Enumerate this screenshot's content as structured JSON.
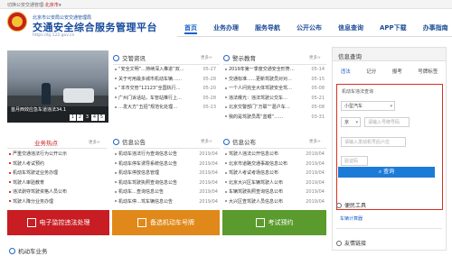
{
  "topbar": {
    "prefix": "切换公安交通管理:",
    "city": "北京市",
    "arrow": "▼"
  },
  "header": {
    "sub": "北京市公安局公安交通管理局",
    "title": "交通安全综合服务管理平台",
    "url": "https://bj.122.gov.cn"
  },
  "nav": [
    {
      "label": "首页"
    },
    {
      "label": "业务办理"
    },
    {
      "label": "服务导航"
    },
    {
      "label": "公开公布"
    },
    {
      "label": "信息查询"
    },
    {
      "label": "APP下载"
    },
    {
      "label": "办事指南"
    }
  ],
  "banner": {
    "caption": "首月西效应急车道违法34.1",
    "dots": [
      "1",
      "2",
      "3",
      "4",
      "5"
    ],
    "active": 3
  },
  "news": {
    "title": "交管资讯",
    "more": "更多>",
    "items": [
      {
        "t": "“安全文明”…持续深入推进“双…",
        "d": "05-27"
      },
      {
        "t": "关于可用最多城市机动车辆……",
        "d": "05-28"
      },
      {
        "t": "“本市交管“12123”全国执行…",
        "d": "05-20"
      },
      {
        "t": "广州门诉话站，车管站推行上…",
        "d": "05-28"
      },
      {
        "t": "…发大方“五招”规范化处理…",
        "d": "05-23"
      }
    ]
  },
  "warn": {
    "title": "警示教育",
    "more": "更多>",
    "items": [
      {
        "t": "2019年第一季度交通安全形势…",
        "d": "05-14"
      },
      {
        "t": "交通标准……更新驾驶员对对…",
        "d": "05-15"
      },
      {
        "t": "一个人问完全大体驾驶安全驾…",
        "d": "05-08"
      },
      {
        "t": "违法曝光：违法驾驶公交车…",
        "d": "05-21"
      },
      {
        "t": "北京交警部门“万联”“葛户车…",
        "d": "05-08"
      },
      {
        "t": "我的是驾驶员再“蓝眼”……",
        "d": "03-31"
      }
    ]
  },
  "hot": {
    "title": "业务热点",
    "more": "更多>",
    "items": [
      "严重交通违法行为公开公示",
      "驾驶人考试预约",
      "机动车驾驶证业务办理",
      "驾驶人审验教育",
      "违法剥夺驾驶资格人员公布",
      "驾驶人降分业务办理"
    ]
  },
  "info": {
    "title": "信息公告",
    "more": "更多>",
    "items": [
      {
        "t": "机动车违法行为查询信息公告",
        "d": "2019/04"
      },
      {
        "t": "机动车停车诱导系统信息公告",
        "d": "2019/04"
      },
      {
        "t": "机动车停放信息管理",
        "d": "2019/04"
      },
      {
        "t": "机动车驾驶执照查询信息公告",
        "d": "2019/04"
      },
      {
        "t": "机动车…查询信息公告",
        "d": "2019/04"
      },
      {
        "t": "机动车停…驾车辆信息公告",
        "d": "2019/04"
      }
    ]
  },
  "pub": {
    "title": "信息公布",
    "more": "更多>",
    "items": [
      {
        "t": "驾驶人违法公开信息公布",
        "d": "2019/04"
      },
      {
        "t": "北京市道路交通事故信息公布",
        "d": "2019/04"
      },
      {
        "t": "驾驶人考试考场信息公布",
        "d": "2019/04"
      },
      {
        "t": "北京大兴区车辆驾驶人公布",
        "d": "2019/04"
      },
      {
        "t": "车辆驾驶执照查询信息公布",
        "d": "2019/04"
      },
      {
        "t": "大兴区查驾驶人员信息公布",
        "d": "2019/04"
      }
    ]
  },
  "bottom": [
    {
      "label": "电子监控违法处理",
      "color": "#c71d23"
    },
    {
      "label": "备选机动车号牌",
      "color": "#e0891a"
    },
    {
      "label": "考试预约",
      "color": "#5b9a2d"
    }
  ],
  "bottomsec": {
    "title": "机动车业务"
  },
  "right": {
    "head": "信息查询",
    "tabs": [
      "违法",
      "记分",
      "报考",
      "号牌标签"
    ],
    "form": {
      "label": "机动车违法查询",
      "type": "小型汽车",
      "prov": "京",
      "plate_ph": "请输入号牌号码",
      "engine_ph": "请输入发动机号后六位",
      "captcha_ph": "验证码",
      "btn": "查询"
    },
    "tools": {
      "title": "便民工具",
      "item": "车辆计算器"
    },
    "links": {
      "title": "友情链接"
    }
  }
}
